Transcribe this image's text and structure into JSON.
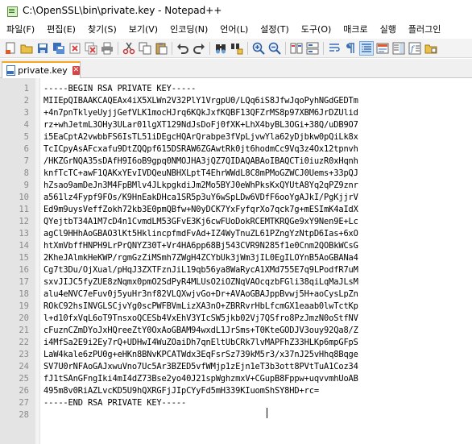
{
  "window": {
    "title": "C:\\OpenSSL\\bin\\private.key - Notepad++"
  },
  "menu": [
    "파일(F)",
    "편집(E)",
    "찾기(S)",
    "보기(V)",
    "인코딩(N)",
    "언어(L)",
    "설정(T)",
    "도구(O)",
    "매크로",
    "실행",
    "플러그인"
  ],
  "toolbar": {
    "icons": [
      "new-file-icon",
      "open-file-icon",
      "save-icon",
      "save-all-icon",
      "close-icon",
      "close-all-icon",
      "print-icon",
      "cut-icon",
      "copy-icon",
      "paste-icon",
      "undo-icon",
      "redo-icon",
      "find-icon",
      "replace-icon",
      "zoom-in-icon",
      "zoom-out-icon",
      "sync-vertical-icon",
      "sync-horizontal-icon",
      "word-wrap-icon",
      "show-all-chars-icon",
      "indent-guide-icon",
      "udl-icon",
      "doc-map-icon",
      "function-list-icon",
      "folder-workspace-icon"
    ]
  },
  "tab": {
    "label": "private.key"
  },
  "editor": {
    "lines": [
      {
        "n": "1",
        "t": "-----BEGIN RSA PRIVATE KEY-----"
      },
      {
        "n": "2",
        "t": "MIIEpQIBAAKCAQEAx4iX5XLWn2V32PlY1VrgpU0/LQq6iS8JfwJqoPyhNGdGEDTm"
      },
      {
        "n": "3",
        "t": "+4n7pnTklyeUyjjGefVLK1mocHJrq6KQkJxfKQBF13QFZrMS8p97XBM6JrDZUlid"
      },
      {
        "n": "4",
        "t": "rz+whJetmL3OHy3ULar01lgXT129NdJsDoFj0fXK+LhX4byBL3OGi+38Q/uDB9O7"
      },
      {
        "n": "5",
        "t": "i5EaCptA2vwbbFS6IsTL51iDEgcHQArQrabpe3fVpLjvwYla62yDjbkw0pQiLk8x"
      },
      {
        "n": "6",
        "t": "TcICpyAsAFcxafu9DtZQQpf615DSRAW6ZGAwtRk0jt6hodmCc9Vq3z4Ox12tpnvh"
      },
      {
        "n": "7",
        "t": "/HKZGrNQA35sDAfH9I6oB9gpq0NMOJHA3jQZ7QIDAQABAoIBAQCTi0iuzR0xHqnh"
      },
      {
        "n": "8",
        "t": "knfTcTC+awF1QAKxYEvIVDQeuNBHXLptT4EhrWWdL8C8mPMoGZWCJ0Uems+33pQJ"
      },
      {
        "n": "9",
        "t": "hZsao9amDeJn3M4FpBMlv4JLkpgkdiJm2Mo5BYJ0eWhPksKxQYUtA8Yq2qPZ9znr"
      },
      {
        "n": "10",
        "t": "a561lz4Fypf9FOs/K9HnEakDHca1SR5p3uY6wSpLDw6VDfF6ooYgAJkI/PgKjjrV"
      },
      {
        "n": "11",
        "t": "Ed9m9uysVeffZokh72kb3E0pmQBfw+N0yDCK7YxFyfqrXo7qck7g+mESImK4aIdX"
      },
      {
        "n": "12",
        "t": "QYejtbT34A1M7cD4n1CvmdLM53GFvE3Kj6cwFUoDokRCEMTKRQGe9xY9Nen9E+Lc"
      },
      {
        "n": "13",
        "t": "agCl9HHhAoGBAO3lKt5HklincpfmdFvAd+IZ4WyTnuZL61PZngYzNtpD6Ias+6xO"
      },
      {
        "n": "14",
        "t": "htXmVbffHNPH9LrPrQNYZ30T+Vr4HA6pp68Bj543CVR9N285f1e0Cnm2QOBkWCsG"
      },
      {
        "n": "15",
        "t": "2KheJAlmkHeKWP/rgmGzZiMSmh7ZWgH4ZCYbUk3jWm3jIL0EgILOYnB5AoGBANa4"
      },
      {
        "n": "16",
        "t": "Cg7t3Du/OjXual/pHqJ3ZXTFznJiL19qb56ya8WaRycA1XMd755E7q9LPodfR7uM"
      },
      {
        "n": "17",
        "t": "sxvJIJC5fyZUE8zNqmx0pmO2SdPyR4MLUsO2iOZNqVAOcqzbFGli38qiLqMaJLsM"
      },
      {
        "n": "18",
        "t": "alu4eNVC7eFuv0j5yuHr3nf82VLQXwjvGo+Dr+AVAoGBAJppBvwj5H+aoCysLpZn"
      },
      {
        "n": "19",
        "t": "ROkC92hsINVGLSCjvYg0scPWFBVmLizXA3nO+ZBRRvrHbLfcmGX1eaab0lwTctKp"
      },
      {
        "n": "20",
        "t": "l+d10fxVqL6oT9TnsxoQCESb4VxEhV3YIcSW5jkb02Vj7QSfro8PzJmzN0oStfNV"
      },
      {
        "n": "21",
        "t": "cFuznCZmDYoJxHQreeZtY0OxAoGBAM94wxdL1JrSms+T0KteGODJV3ouy92Qa8/Z"
      },
      {
        "n": "22",
        "t": "i4MfSa2E9i2Ey7rQ+UDHwI4WuZOaiDh7qnEltUbCRk7lvMAPFhZ33HLKp6mpGFpS"
      },
      {
        "n": "23",
        "t": "LaW4kale6zPU0g+eHKn8BNvKPCATWdx3EqFsrSz739kM5r3/x37nJ25vHhq8Bqge"
      },
      {
        "n": "24",
        "t": "SV7U0rNFAoGAJxwuVno7Uc5Ar3BZED5vfWMjp1zEjn1eT3b3ott8PVtTuA1Coz34"
      },
      {
        "n": "25",
        "t": "fJ1tSAnGFngIki4mI4dZ73Bse2yo40J21spWghzmxV+CGupB8Fppw+uqvvmhUoAB"
      },
      {
        "n": "26",
        "t": "495m8v0RiAZLvcKD5U9hQXRGFjJIpCYyFd5mH339KIuomShSY8HD+rc="
      },
      {
        "n": "27",
        "t": "-----END RSA PRIVATE KEY-----"
      },
      {
        "n": "28",
        "t": ""
      }
    ]
  }
}
